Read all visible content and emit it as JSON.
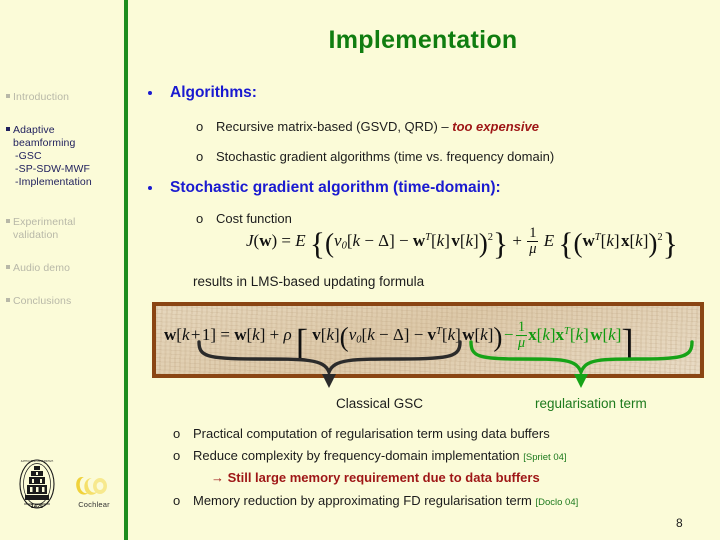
{
  "slide": {
    "title": "Implementation",
    "page_number": "8",
    "title_color": "#107d10",
    "background_color": "#fbfbd8",
    "divider_color": "#1e8c1e"
  },
  "sidebar": {
    "items": [
      {
        "label": "Introduction",
        "active": false
      },
      {
        "label": "Adaptive",
        "label_line2": "beamforming",
        "active": true,
        "sub": [
          "-GSC",
          "-SP-SDW-MWF",
          "-Implementation"
        ]
      },
      {
        "label": "Experimental",
        "label_line2": "validation",
        "active": false
      },
      {
        "label": "Audio demo",
        "active": false
      },
      {
        "label": "Conclusions",
        "active": false
      }
    ],
    "logos": {
      "seal_year": "1425",
      "cochlear_label": "Cochlear"
    }
  },
  "content": {
    "bullet1": "Algorithms:",
    "sub1a_text": "Recursive matrix-based (GSVD, QRD) – ",
    "sub1a_emph": "too expensive",
    "sub1b": "Stochastic gradient algorithms (time vs. frequency domain)",
    "bullet2": "Stochastic gradient algorithm (time-domain):",
    "sub2a": "Cost function",
    "results_line": "results in LMS-based updating formula",
    "brace_label_left": "Classical GSC",
    "brace_label_right": "regularisation term",
    "sub3a": "Practical computation of regularisation term using data buffers",
    "sub3b": "Reduce complexity by frequency-domain implementation",
    "sub3b_cite": "[Spriet 04]",
    "sub3b_arrow": "→ Still large memory requirement due to data buffers",
    "sub3c": "Memory reduction by approximating FD regularisation term",
    "sub3c_cite": "[Doclo 04]",
    "list_marker": "o",
    "equations": {
      "cost_function": "J(w) = E { ( v0[k − Δ] − w^T[k] v[k] )^2 } + (1/μ) E { ( w^T[k] x[k] )^2 }",
      "update_formula": "w[k+1] = w[k] + ρ [ v[k] ( v0[k − Δ] − v^T[k] w[k] ) − (1/μ) x[k] x^T[k] w[k] ]"
    }
  },
  "colors": {
    "bullet_blue": "#1a1ad0",
    "emph_red": "#9e1616",
    "cite_green": "#1d7a1d",
    "reg_green": "#0f9a0f",
    "box_border": "#8a4513",
    "box_fill": "#e3d2b4",
    "sidebar_inactive": "#b8b8a8",
    "sidebar_active": "#21215e"
  }
}
